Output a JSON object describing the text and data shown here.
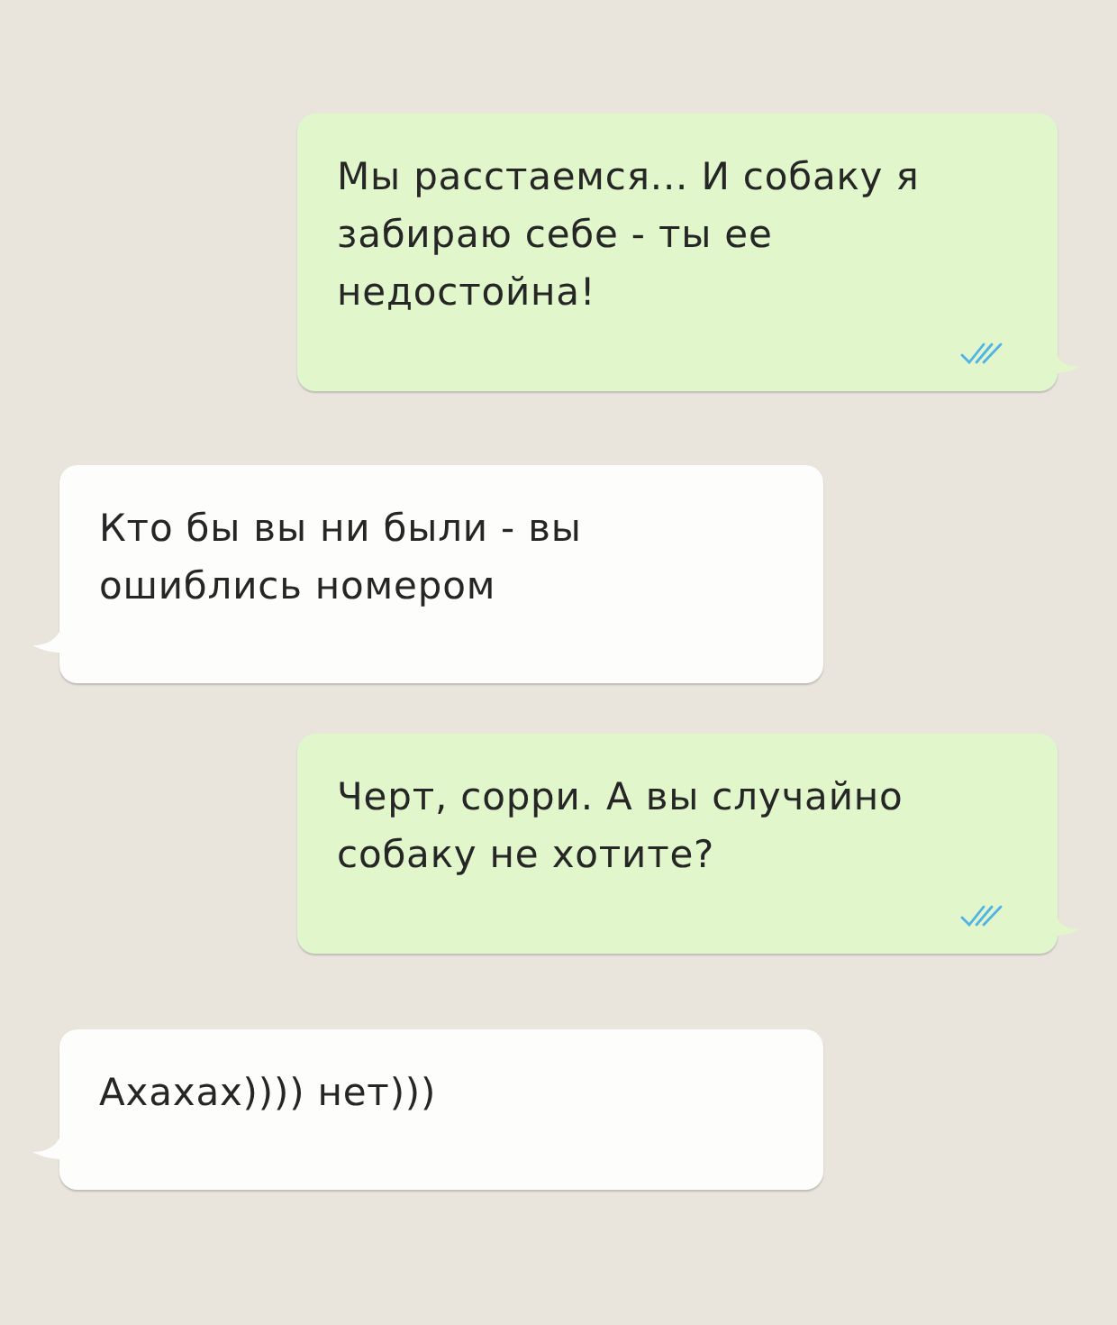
{
  "messages": [
    {
      "kind": "outgoing",
      "text": "Мы расстаемся... И собаку я забираю себе - ты ее недостойна!",
      "read": true
    },
    {
      "kind": "incoming",
      "text": "Кто бы вы ни были - вы ошиблись номером"
    },
    {
      "kind": "outgoing",
      "text": "Черт, сорри. А вы случайно собаку не хотите?",
      "read": true
    },
    {
      "kind": "incoming",
      "text": "Ахахах)))) нет)))"
    }
  ]
}
